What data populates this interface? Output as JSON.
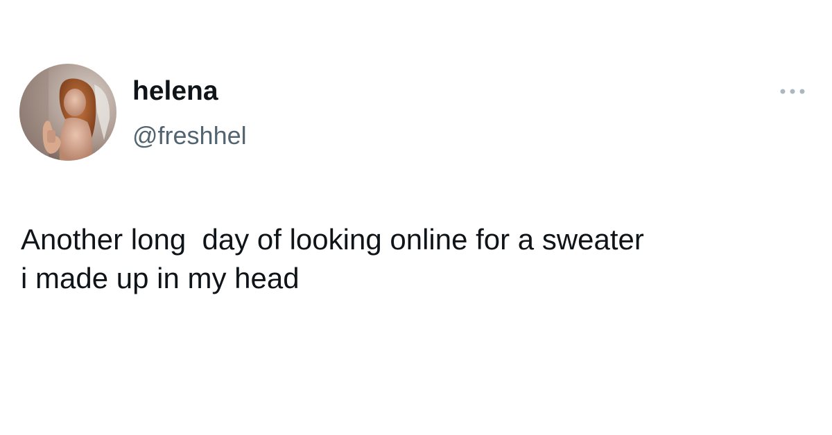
{
  "tweet": {
    "author": {
      "display_name": "helena",
      "handle": "@freshhel",
      "avatar": "profile-photo"
    },
    "more_icon": "more-horizontal-icon",
    "text": "Another long  day of looking online for a sweater\ni made up in my head"
  },
  "colors": {
    "background": "#ffffff",
    "primary_text": "#0f1419",
    "secondary_text": "#536471",
    "more_icon": "#aab8c2"
  }
}
